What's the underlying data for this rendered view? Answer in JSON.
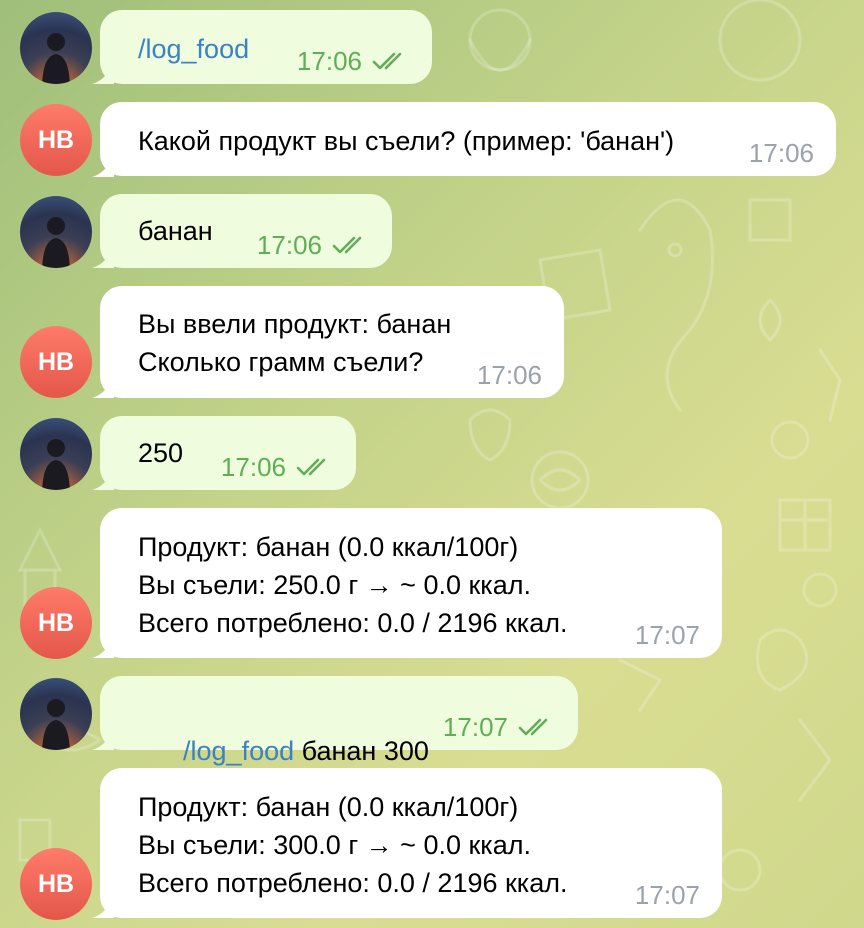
{
  "colors": {
    "out_bubble": "#effdde",
    "in_bubble": "#ffffff",
    "command_link": "#3a82c4",
    "out_time": "#5fae55",
    "in_time": "#9aa3ab",
    "bot_avatar": "#e3574a"
  },
  "bot": {
    "initials": "НВ"
  },
  "messages": [
    {
      "direction": "out",
      "avatar": "user-photo",
      "command": "/log_food",
      "text": "",
      "time": "17:06",
      "status": "read-double-check-icon"
    },
    {
      "direction": "in",
      "avatar": "bot-initials",
      "lines": [
        "Какой продукт вы съели? (пример: 'банан')"
      ],
      "time": "17:06"
    },
    {
      "direction": "out",
      "avatar": "user-photo",
      "text": "банан",
      "time": "17:06",
      "status": "read-double-check-icon"
    },
    {
      "direction": "in",
      "avatar": "bot-initials",
      "lines": [
        "Вы ввели продукт: банан",
        "Сколько грамм съели?"
      ],
      "time": "17:06"
    },
    {
      "direction": "out",
      "avatar": "user-photo",
      "text": "250",
      "time": "17:06",
      "status": "read-double-check-icon"
    },
    {
      "direction": "in",
      "avatar": "bot-initials",
      "lines": [
        "Продукт: банан (0.0 ккал/100г)",
        "Вы съели: 250.0 г → ~ 0.0 ккал.",
        "Всего потреблено: 0.0 / 2196 ккал."
      ],
      "time": "17:07"
    },
    {
      "direction": "out",
      "avatar": "user-photo",
      "command": "/log_food",
      "text": " банан 300",
      "time": "17:07",
      "status": "read-double-check-icon"
    },
    {
      "direction": "in",
      "avatar": "bot-initials",
      "lines": [
        "Продукт: банан (0.0 ккал/100г)",
        "Вы съели: 300.0 г → ~ 0.0 ккал.",
        "Всего потреблено: 0.0 / 2196 ккал."
      ],
      "time": "17:07"
    }
  ]
}
